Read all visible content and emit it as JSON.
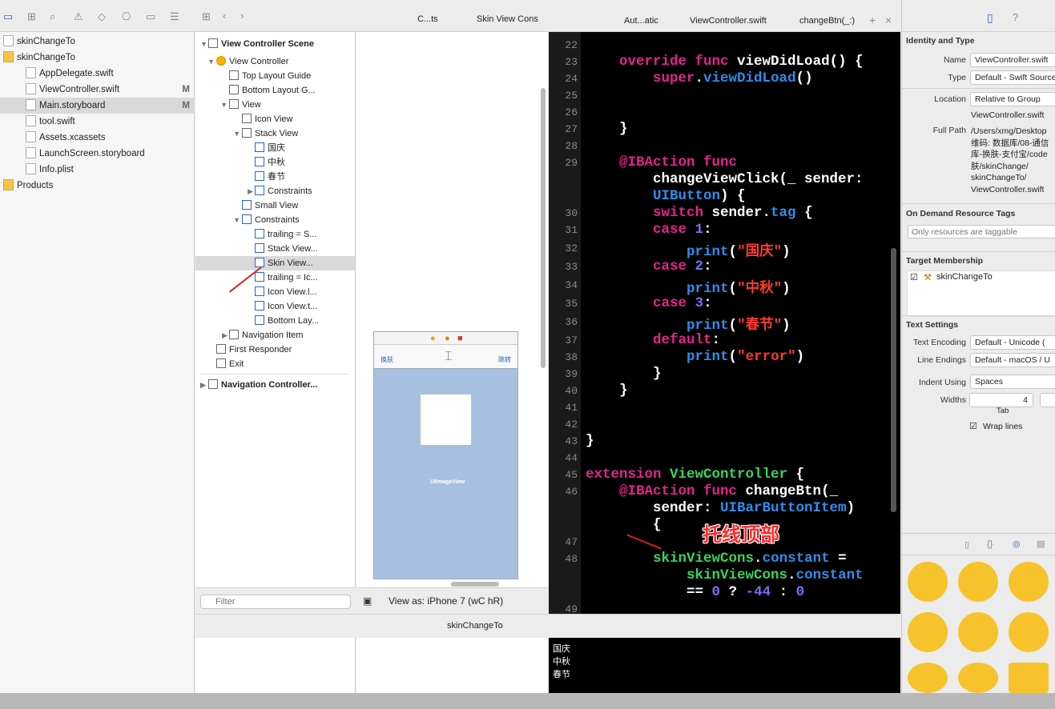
{
  "navigator": {
    "files": [
      {
        "label": "skinChangeTo",
        "icon": "project-icon",
        "indent": 1,
        "mod": ""
      },
      {
        "label": "skinChangeTo",
        "icon": "folder-icon",
        "indent": 1,
        "mod": ""
      },
      {
        "label": "AppDelegate.swift",
        "icon": "swift-file-icon",
        "indent": 3,
        "mod": ""
      },
      {
        "label": "ViewController.swift",
        "icon": "swift-file-icon",
        "indent": 3,
        "mod": "M"
      },
      {
        "label": "Main.storyboard",
        "icon": "storyboard-icon",
        "indent": 3,
        "mod": "M"
      },
      {
        "label": "tool.swift",
        "icon": "swift-file-icon",
        "indent": 3,
        "mod": ""
      },
      {
        "label": "Assets.xcassets",
        "icon": "assets-icon",
        "indent": 3,
        "mod": ""
      },
      {
        "label": "LaunchScreen.storyboard",
        "icon": "storyboard-icon",
        "indent": 3,
        "mod": ""
      },
      {
        "label": "Info.plist",
        "icon": "plist-icon",
        "indent": 3,
        "mod": ""
      },
      {
        "label": "Products",
        "icon": "folder-icon",
        "indent": 1,
        "mod": ""
      }
    ]
  },
  "outline": {
    "scene": "View Controller Scene",
    "items": [
      "View Controller",
      "Top Layout Guide",
      "Bottom Layout G...",
      "View",
      "Icon View",
      "Stack View",
      "国庆",
      "中秋",
      "春节",
      "Constraints",
      "Small View",
      "Constraints",
      "trailing = S...",
      "Stack View...",
      "Skin View...",
      "trailing = Ic...",
      "Icon View.l...",
      "Icon View.t...",
      "Bottom Lay...",
      "Navigation Item",
      "First Responder",
      "Exit"
    ],
    "nav_scene": "Navigation Controller...",
    "filter_placeholder": "Filter"
  },
  "canvas": {
    "left_btn": "换肤",
    "right_btn": "跳转",
    "image_label": "UIImageView",
    "view_as": "View as: iPhone 7 (wC hR)"
  },
  "breadcrumb_left": {
    "a": "C...ts",
    "b": "Skin View Cons"
  },
  "breadcrumb_right": {
    "a": "Aut...atic",
    "b": "ViewController.swift",
    "c": "changeBtn(_:)"
  },
  "debug_bar": {
    "target": "skinChangeTo"
  },
  "code": {
    "annotation": "托线顶部"
  },
  "console": {
    "lines": [
      "国庆",
      "中秋",
      "春节"
    ]
  },
  "inspector": {
    "identity_title": "Identity and Type",
    "name_label": "Name",
    "name": "ViewController.swift",
    "type_label": "Type",
    "type": "Default - Swift Source",
    "location_label": "Location",
    "location": "Relative to Group",
    "loc_file": "ViewController.swift",
    "fullpath_label": "Full Path",
    "fullpath": [
      "/Users/xmg/Desktop",
      "维码: 数据库/08-通信",
      "库-换肤-支付宝/code",
      "肤/skinChange/",
      "skinChangeTo/",
      "ViewController.swift"
    ],
    "ondemand_title": "On Demand Resource Tags",
    "ondemand_placeholder": "Only resources are taggable",
    "target_title": "Target Membership",
    "target": "skinChangeTo",
    "text_title": "Text Settings",
    "enc_label": "Text Encoding",
    "enc": "Default - Unicode (",
    "le_label": "Line Endings",
    "le": "Default - macOS / U",
    "indent_label": "Indent Using",
    "indent": "Spaces",
    "widths_label": "Widths",
    "width_val": "4",
    "tab_label": "Tab",
    "wrap_label": "Wrap lines"
  },
  "colors": {
    "accent": "#2a64c8",
    "keyword": "#e3238f",
    "string": "#ff3b30",
    "type": "#2f8ee9",
    "annotation": "#ff2a2a"
  }
}
